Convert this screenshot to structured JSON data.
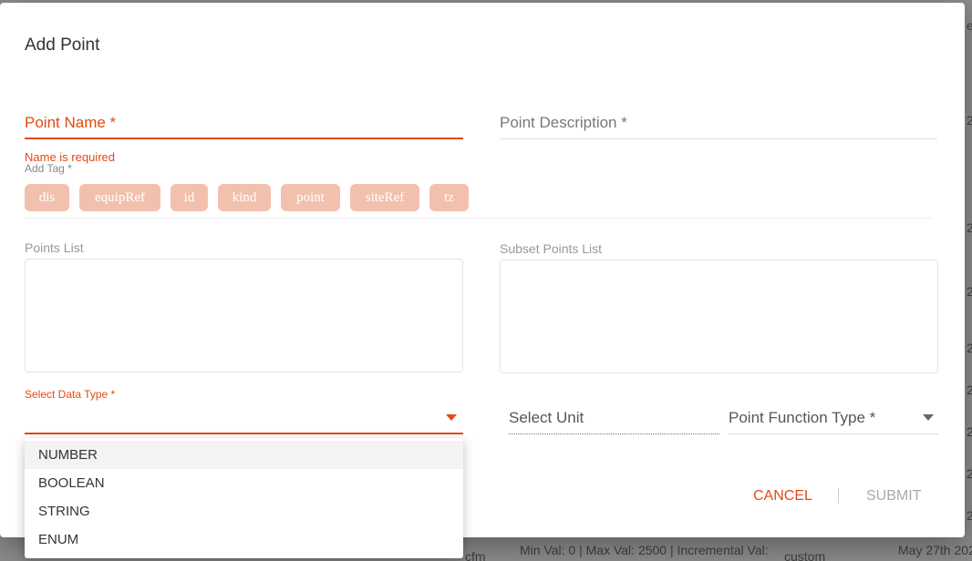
{
  "dialog": {
    "title": "Add Point"
  },
  "form": {
    "point_name": {
      "label": "Point Name *",
      "error": "Name is required"
    },
    "point_description": {
      "label": "Point Description *"
    },
    "add_tag": {
      "label": "Add Tag *",
      "chips": [
        "dis",
        "equipRef",
        "id",
        "kind",
        "point",
        "siteRef",
        "tz"
      ]
    },
    "points_list": {
      "label": "Points List"
    },
    "subset_points_list": {
      "label": "Subset Points List"
    },
    "data_type": {
      "label": "Select Data Type *",
      "options": [
        "NUMBER",
        "BOOLEAN",
        "STRING",
        "ENUM"
      ]
    },
    "unit": {
      "placeholder": "Select Unit"
    },
    "function_type": {
      "label": "Point Function Type *"
    }
  },
  "actions": {
    "cancel": "CANCEL",
    "submit": "SUBMIT"
  },
  "background": {
    "row_text_1": "cfm",
    "row_text_2": "Min Val: 0 | Max Val: 2500 | Incremental Val:",
    "row_text_3": "custom",
    "row_text_4": "May 27th 202",
    "edge_chars": [
      "e",
      "2",
      "2",
      "2",
      "2",
      "2",
      "2",
      "2",
      "2"
    ]
  },
  "colors": {
    "accent": "#e24a12",
    "chip_bg": "#f2c1ae",
    "overlay": "#7a7a7a"
  }
}
